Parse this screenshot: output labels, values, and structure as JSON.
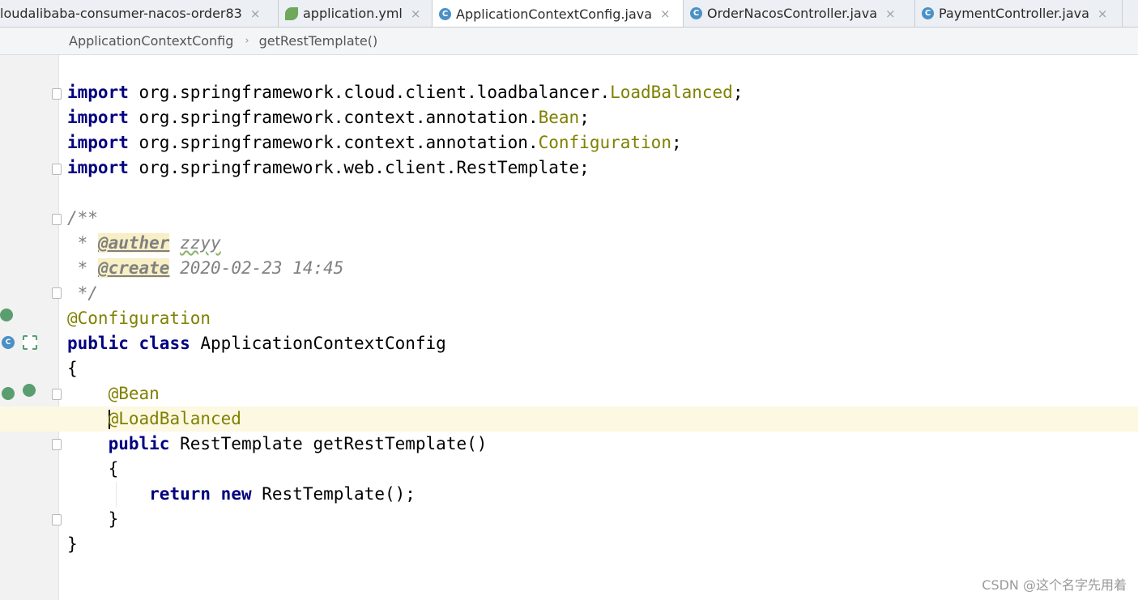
{
  "tabs": [
    {
      "label": "loudalibaba-consumer-nacos-order83",
      "icon": "module-icon",
      "active": false
    },
    {
      "label": "application.yml",
      "icon": "spring-yml-icon",
      "active": false
    },
    {
      "label": "ApplicationContextConfig.java",
      "icon": "java-class-icon",
      "active": true
    },
    {
      "label": "OrderNacosController.java",
      "icon": "java-class-icon",
      "active": false
    },
    {
      "label": "PaymentController.java",
      "icon": "java-class-icon",
      "active": false
    }
  ],
  "close_glyph": "×",
  "breadcrumb": {
    "class_name": "ApplicationContextConfig",
    "separator": "›",
    "method": "getRestTemplate()"
  },
  "code": {
    "import_kw": "import",
    "imports": [
      {
        "pkg": "org.springframework.cloud.client.loadbalancer.",
        "cls": "LoadBalanced",
        "cls_colored": true
      },
      {
        "pkg": "org.springframework.context.annotation.",
        "cls": "Bean",
        "cls_colored": true
      },
      {
        "pkg": "org.springframework.context.annotation.",
        "cls": "Configuration",
        "cls_colored": true
      },
      {
        "pkg": "org.springframework.web.client.",
        "cls": "RestTemplate",
        "cls_colored": false
      }
    ],
    "semicolon": ";",
    "javadoc_open": "/**",
    "javadoc_star": " * ",
    "author_tag": "@auther",
    "author_value": "zzyy",
    "create_tag": "@create",
    "create_value": "2020-02-23 14:45",
    "javadoc_close": " */",
    "class_annotation": "@Configuration",
    "kw_public": "public",
    "kw_class": "class",
    "class_name": "ApplicationContextConfig",
    "open_brace": "{",
    "close_brace": "}",
    "bean_annotation": "@Bean",
    "lb_at": "@",
    "lb_rest": "LoadBalanced",
    "method_rest": "RestTemplate getRestTemplate()",
    "kw_return": "return",
    "kw_new": "new",
    "return_rest": "RestTemplate();"
  },
  "watermark": "CSDN @这个名字先用着"
}
